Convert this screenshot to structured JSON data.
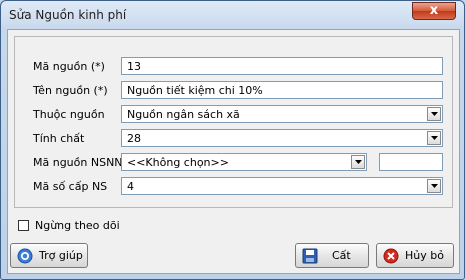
{
  "window": {
    "title": "Sửa Nguồn kinh phí",
    "close_label": "x"
  },
  "form": {
    "ma_nguon": {
      "label": "Mã nguồn (*)",
      "value": "13"
    },
    "ten_nguon": {
      "label": "Tên nguồn (*)",
      "value": "Nguồn tiết kiệm chi 10%"
    },
    "thuoc_nguon": {
      "label": "Thuộc nguồn",
      "value": "Nguồn ngân sách xã"
    },
    "tinh_chat": {
      "label": "Tính chất",
      "value": "28"
    },
    "ma_nguon_nsnn": {
      "label": "Mã nguồn NSNN",
      "value": "<<Không chọn>>",
      "extra_value": ""
    },
    "ma_so_cap_ns": {
      "label": "Mã số cấp NS",
      "value": "4"
    }
  },
  "options": {
    "ngung_theo_doi": {
      "label": "Ngừng theo dõi",
      "checked": false
    }
  },
  "buttons": {
    "help": "Trợ giúp",
    "save": "Cất",
    "cancel": "Hủy bỏ"
  },
  "colors": {
    "title_bar": "#c7d8ec",
    "close_button": "#c2391b",
    "field_border": "#7f9db9"
  }
}
